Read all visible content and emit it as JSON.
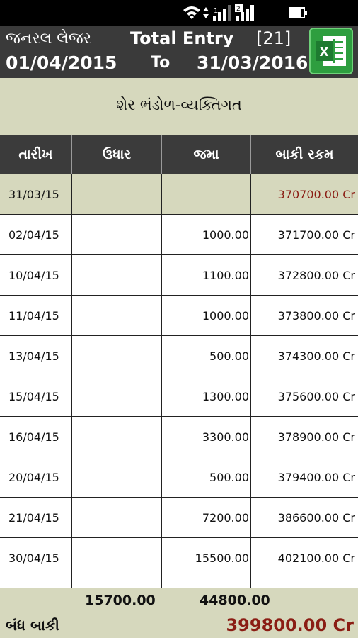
{
  "status_bar": {
    "icons": [
      "wifi-icon",
      "data-transfer-icon",
      "signal-icon-1",
      "signal-icon-2",
      "battery-icon"
    ]
  },
  "header": {
    "ledger_label": "જનરલ લેજર",
    "total_entry_label": "Total Entry",
    "entry_count": "[21]",
    "from_date": "01/04/2015",
    "to_label": "To",
    "to_date": "31/03/2016",
    "export_icon": "excel-icon",
    "excel_letter": "X"
  },
  "account": {
    "name": "શેર ભંડોળ-વ્યક્તિગત"
  },
  "table": {
    "columns": [
      "તારીખ",
      "ઉધાર",
      "જમા",
      "બાકી રકમ"
    ],
    "rows": [
      {
        "date": "31/03/15",
        "debit": "",
        "credit": "",
        "balance": "370700.00 Cr"
      },
      {
        "date": "02/04/15",
        "debit": "",
        "credit": "1000.00",
        "balance": "371700.00 Cr"
      },
      {
        "date": "10/04/15",
        "debit": "",
        "credit": "1100.00",
        "balance": "372800.00 Cr"
      },
      {
        "date": "11/04/15",
        "debit": "",
        "credit": "1000.00",
        "balance": "373800.00 Cr"
      },
      {
        "date": "13/04/15",
        "debit": "",
        "credit": "500.00",
        "balance": "374300.00 Cr"
      },
      {
        "date": "15/04/15",
        "debit": "",
        "credit": "1300.00",
        "balance": "375600.00 Cr"
      },
      {
        "date": "16/04/15",
        "debit": "",
        "credit": "3300.00",
        "balance": "378900.00 Cr"
      },
      {
        "date": "20/04/15",
        "debit": "",
        "credit": "500.00",
        "balance": "379400.00 Cr"
      },
      {
        "date": "21/04/15",
        "debit": "",
        "credit": "7200.00",
        "balance": "386600.00 Cr"
      },
      {
        "date": "30/04/15",
        "debit": "",
        "credit": "15500.00",
        "balance": "402100.00 Cr"
      },
      {
        "date": "",
        "debit": "",
        "credit": "",
        "balance": ""
      }
    ]
  },
  "footer": {
    "debit_total": "15700.00",
    "credit_total": "44800.00",
    "closing_label": "બંધ બાકી",
    "closing_balance": "399800.00 Cr"
  },
  "colors": {
    "header_bg": "#3a3a3a",
    "band_bg": "#d6d8bd",
    "balance_red": "#8b1d14",
    "excel_green": "#2e9e3f"
  }
}
